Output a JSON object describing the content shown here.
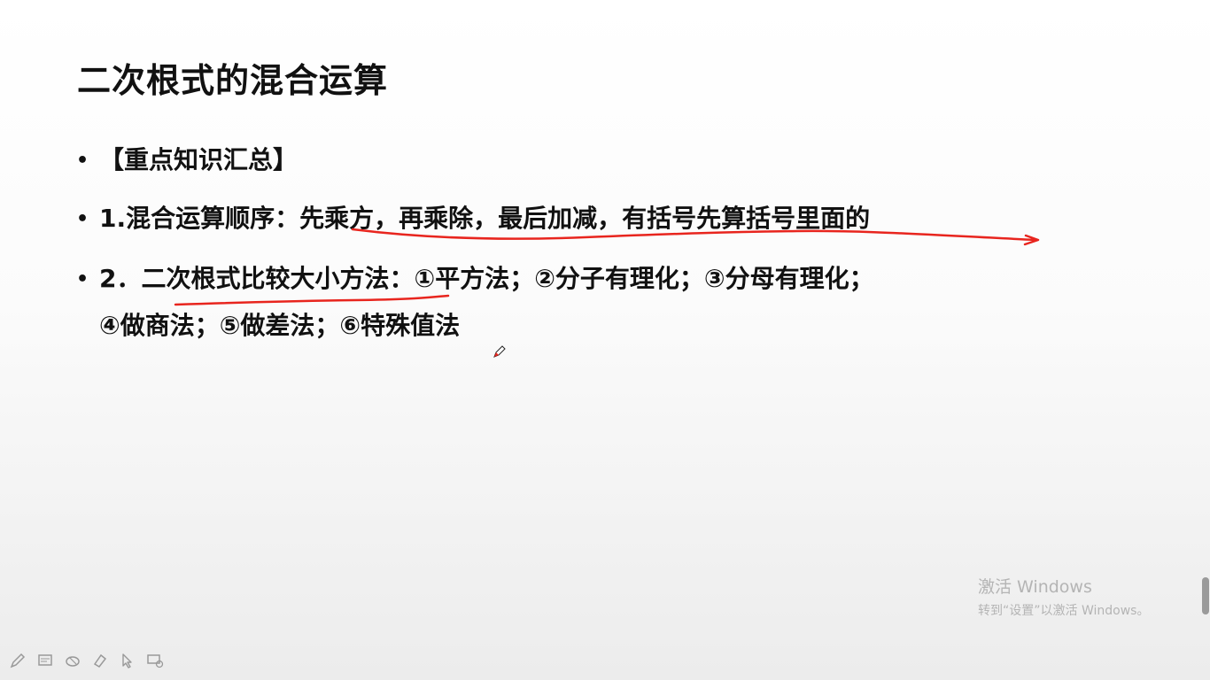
{
  "slide": {
    "title": "二次根式的混合运算",
    "bullets": [
      {
        "text": "【重点知识汇总】"
      },
      {
        "prefix": "1.混合运算顺序：",
        "emphasis": "先乘方，再乘除，最后加减，有括号先算括号里面的"
      },
      {
        "prefix": "2．",
        "emphasis": "二次根式比较大小方法",
        "rest": "：①平方法；②分子有理化；③分母有理化；",
        "continuation": "④做商法；⑤做差法；⑥特殊值法"
      }
    ]
  },
  "watermark": {
    "title": "激活 Windows",
    "subtitle": "转到“设置”以激活 Windows。"
  },
  "annotation_color": "#e8251e",
  "toolbar": {
    "icons": [
      "pen-icon",
      "screen-icon",
      "eraser-icon",
      "highlighter-icon",
      "pointer-icon",
      "presentation-icon"
    ]
  }
}
